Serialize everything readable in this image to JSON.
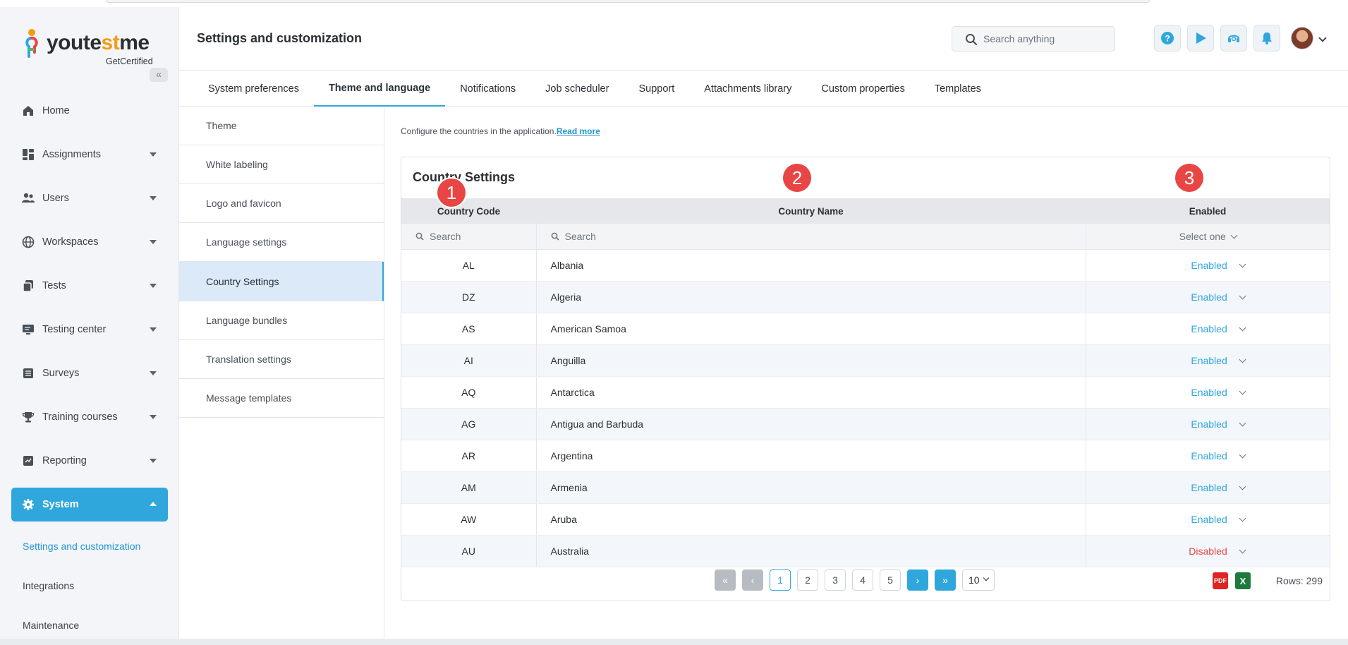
{
  "brand": {
    "name_main": "youte",
    "name_accent": "st",
    "name_end": "me",
    "subtitle": "GetCertified"
  },
  "sidebar": {
    "items": [
      {
        "label": "Home",
        "icon": "home-icon",
        "has_caret": false
      },
      {
        "label": "Assignments",
        "icon": "dashboard-icon",
        "has_caret": true
      },
      {
        "label": "Users",
        "icon": "users-icon",
        "has_caret": true
      },
      {
        "label": "Workspaces",
        "icon": "globe-icon",
        "has_caret": true
      },
      {
        "label": "Tests",
        "icon": "copy-icon",
        "has_caret": true
      },
      {
        "label": "Testing center",
        "icon": "monitor-icon",
        "has_caret": true
      },
      {
        "label": "Surveys",
        "icon": "list-icon",
        "has_caret": true
      },
      {
        "label": "Training courses",
        "icon": "trophy-icon",
        "has_caret": true
      },
      {
        "label": "Reporting",
        "icon": "chart-icon",
        "has_caret": true
      },
      {
        "label": "System",
        "icon": "gear-icon",
        "has_caret": true,
        "active": true
      }
    ],
    "subitems": [
      {
        "label": "Settings and customization",
        "current": true
      },
      {
        "label": "Integrations"
      },
      {
        "label": "Maintenance"
      }
    ]
  },
  "header": {
    "title": "Settings and customization",
    "search_placeholder": "Search anything"
  },
  "tabs": [
    {
      "label": "System preferences"
    },
    {
      "label": "Theme and language",
      "active": true
    },
    {
      "label": "Notifications"
    },
    {
      "label": "Job scheduler"
    },
    {
      "label": "Support"
    },
    {
      "label": "Attachments library"
    },
    {
      "label": "Custom properties"
    },
    {
      "label": "Templates"
    }
  ],
  "settings_menu": [
    {
      "label": "Theme"
    },
    {
      "label": "White labeling"
    },
    {
      "label": "Logo and favicon"
    },
    {
      "label": "Language settings"
    },
    {
      "label": "Country Settings",
      "active": true
    },
    {
      "label": "Language bundles"
    },
    {
      "label": "Translation settings"
    },
    {
      "label": "Message templates"
    }
  ],
  "content": {
    "description": "Configure the countries in the application.",
    "read_more": "Read more",
    "card_title": "Country Settings",
    "badges": [
      "1",
      "2",
      "3"
    ],
    "columns": {
      "code": "Country Code",
      "name": "Country Name",
      "enabled": "Enabled"
    },
    "filters": {
      "code_placeholder": "Search",
      "name_placeholder": "Search",
      "enabled_select": "Select one"
    },
    "rows": [
      {
        "code": "AL",
        "name": "Albania",
        "status": "Enabled"
      },
      {
        "code": "DZ",
        "name": "Algeria",
        "status": "Enabled"
      },
      {
        "code": "AS",
        "name": "American Samoa",
        "status": "Enabled"
      },
      {
        "code": "AI",
        "name": "Anguilla",
        "status": "Enabled"
      },
      {
        "code": "AQ",
        "name": "Antarctica",
        "status": "Enabled"
      },
      {
        "code": "AG",
        "name": "Antigua and Barbuda",
        "status": "Enabled"
      },
      {
        "code": "AR",
        "name": "Argentina",
        "status": "Enabled"
      },
      {
        "code": "AM",
        "name": "Armenia",
        "status": "Enabled"
      },
      {
        "code": "AW",
        "name": "Aruba",
        "status": "Enabled"
      },
      {
        "code": "AU",
        "name": "Australia",
        "status": "Disabled"
      }
    ],
    "pagination": {
      "pages": [
        "1",
        "2",
        "3",
        "4",
        "5"
      ],
      "current_page": "1",
      "page_size": "10",
      "rows_label": "Rows: 299"
    },
    "export": {
      "pdf": "PDF",
      "excel": "X"
    }
  },
  "colors": {
    "accent": "#2fa7dd",
    "disabled": "#e84545",
    "badge": "#e84545"
  }
}
